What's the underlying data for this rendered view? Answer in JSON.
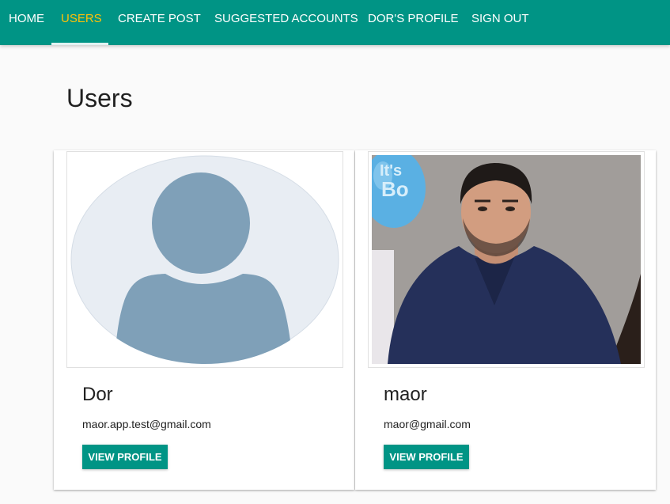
{
  "nav": {
    "items": [
      {
        "label": "HOME",
        "active": false
      },
      {
        "label": "USERS",
        "active": true
      },
      {
        "label": "CREATE POST",
        "active": false
      },
      {
        "label": "SUGGESTED ACCOUNTS",
        "active": false
      },
      {
        "label": "DOR'S PROFILE",
        "active": false
      },
      {
        "label": "SIGN OUT",
        "active": false
      }
    ]
  },
  "page": {
    "title": "Users"
  },
  "users": [
    {
      "name": "Dor",
      "email": "maor.app.test@gmail.com",
      "button_label": "VIEW PROFILE",
      "avatar": "default-avatar-placeholder"
    },
    {
      "name": "maor",
      "email": "maor@gmail.com",
      "button_label": "VIEW PROFILE",
      "avatar": "profile-photo"
    }
  ],
  "colors": {
    "primary": "#009485",
    "active_nav": "#ffc107",
    "background": "#fafafa",
    "placeholder_bg": "#e8edf3",
    "placeholder_figure": "#7fa0b8"
  }
}
